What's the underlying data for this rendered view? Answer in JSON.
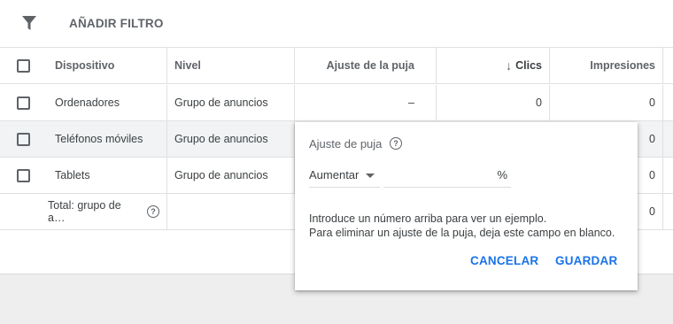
{
  "toolbar": {
    "filter_label": "AÑADIR FILTRO"
  },
  "table": {
    "headers": {
      "device": "Dispositivo",
      "level": "Nivel",
      "bid_adjustment": "Ajuste de la puja",
      "sort_arrow": "↓",
      "clicks": "Clics",
      "impressions": "Impresiones"
    },
    "rows": [
      {
        "device": "Ordenadores",
        "level": "Grupo de anuncios",
        "bid_adjustment": "–",
        "clicks": "0",
        "impressions": "0"
      },
      {
        "device": "Teléfonos móviles",
        "level": "Grupo de anuncios",
        "bid_adjustment": "",
        "clicks": "",
        "impressions": "0"
      },
      {
        "device": "Tablets",
        "level": "Grupo de anuncios",
        "bid_adjustment": "",
        "clicks": "",
        "impressions": "0"
      }
    ],
    "total": {
      "label": "Total: grupo de a…",
      "impressions": "0"
    }
  },
  "popup": {
    "title": "Ajuste de puja",
    "help_icon": "?",
    "dropdown_value": "Aumentar",
    "percent_value": "",
    "percent_sign": "%",
    "help_line1": "Introduce un número arriba para ver un ejemplo.",
    "help_line2": "Para eliminar un ajuste de la puja, deja este campo en blanco.",
    "cancel_label": "CANCELAR",
    "save_label": "GUARDAR"
  },
  "colors": {
    "accent": "#1a73e8",
    "row_highlight": "#f1f3f4"
  },
  "icons": {
    "filter": "filter-icon",
    "help": "help-icon",
    "dropdown": "dropdown-arrow-icon",
    "sort": "arrow-down-icon"
  }
}
